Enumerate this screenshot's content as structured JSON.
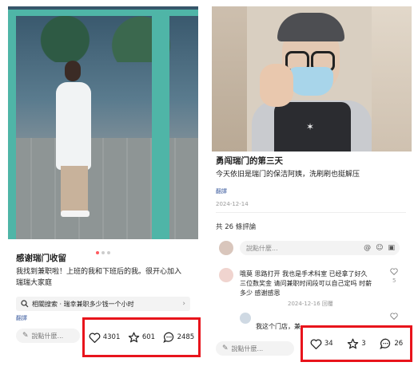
{
  "left_post": {
    "title": "感谢瑞门收留",
    "body_line1": "我找到兼职啦！上班的我和下班后的我。很开心加入",
    "body_line2": "瑞瑞大家庭",
    "related_search": "相關搜索 · 瑞幸兼职多少钱一个小时",
    "translate": "翻譯",
    "comment_placeholder": "說點什麼...",
    "likes": "4301",
    "favorites": "601",
    "comments": "2485"
  },
  "right_post": {
    "title": "勇闯瑞门的第三天",
    "body": "今天依旧是瑞门的保洁阿姨，洗刷刷也挺解压",
    "translate": "翻譯",
    "date": "2024-12-14",
    "comment_count": "共 26 條評論",
    "comment_input_placeholder": "說點什麼...",
    "comment1": {
      "line1": "哦莫 思路打开 我也是手术科室 已经拿了好久",
      "line2": "三位数奖金 请问兼职时间段可以自己定吗 时薪",
      "line3": "多少 感谢感恩",
      "meta": "2024-12-16 回覆",
      "like_count": "5"
    },
    "reply_snippet": "我这个门店，兼",
    "comment_placeholder": "說點什麼...",
    "likes": "34",
    "favorites": "3",
    "comments": "26"
  },
  "colors": {
    "highlight_border": "#e8141c",
    "link": "#3b5b9e",
    "accent_dot": "#ff5a5f"
  }
}
